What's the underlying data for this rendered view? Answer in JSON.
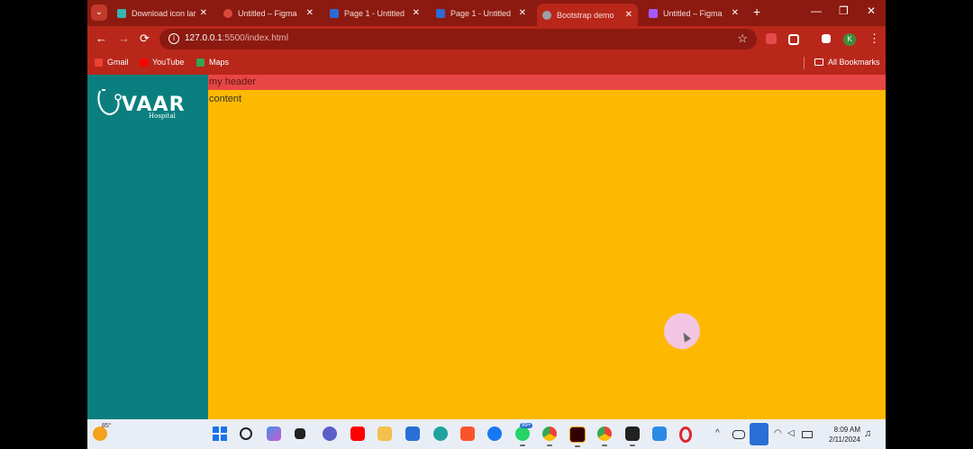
{
  "tabs": [
    {
      "title": "Download icon lar",
      "icon_color": "#37b3b0",
      "active": false
    },
    {
      "title": "Untitled – Figma",
      "icon_color": "#d9493a",
      "active": false
    },
    {
      "title": "Page 1 - Untitled",
      "icon_color": "#2c6bd6",
      "active": false
    },
    {
      "title": "Page 1 - Untitled",
      "icon_color": "#2c6bd6",
      "active": false
    },
    {
      "title": "Bootstrap demo",
      "icon_color": "#9aa0a6",
      "active": true
    },
    {
      "title": "Untitled – Figma",
      "icon_color": "#a259ff",
      "active": false
    }
  ],
  "tab_close_glyph": "✕",
  "new_tab_glyph": "+",
  "window_controls": {
    "minimize": "—",
    "restore": "❐",
    "close": "✕"
  },
  "toolbar": {
    "back": "←",
    "forward": "→",
    "reload": "⟳",
    "url_host": "127.0.0.1",
    "url_rest": ":5500/index.html",
    "star": "☆",
    "profile_initial": "K",
    "menu": "⋮"
  },
  "bookmarks": [
    {
      "label": "Gmail",
      "icon_color": "#ea4335"
    },
    {
      "label": "YouTube",
      "icon_color": "#ff0000"
    },
    {
      "label": "Maps",
      "icon_color": "#34a853"
    }
  ],
  "all_bookmarks": "All Bookmarks",
  "page": {
    "logo_text": "VAAR",
    "logo_sub": "Hospital",
    "header_text": "my header",
    "content_text": "content",
    "colors": {
      "sidebar": "#0b7f7f",
      "main": "#fdb900",
      "header": "#e84545"
    }
  },
  "taskbar": {
    "temperature": "85°",
    "apps": [
      "windows-start",
      "search",
      "copilot",
      "task-view",
      "teams-chat",
      "youtube",
      "file-explorer",
      "microsoft-store",
      "edge",
      "brave",
      "facebook",
      "whatsapp",
      "chrome-profile",
      "illustrator",
      "chrome",
      "terminal",
      "vscode",
      "opera"
    ],
    "whatsapp_badge": "99+",
    "time": "8:09 AM",
    "date": "2/11/2024"
  }
}
